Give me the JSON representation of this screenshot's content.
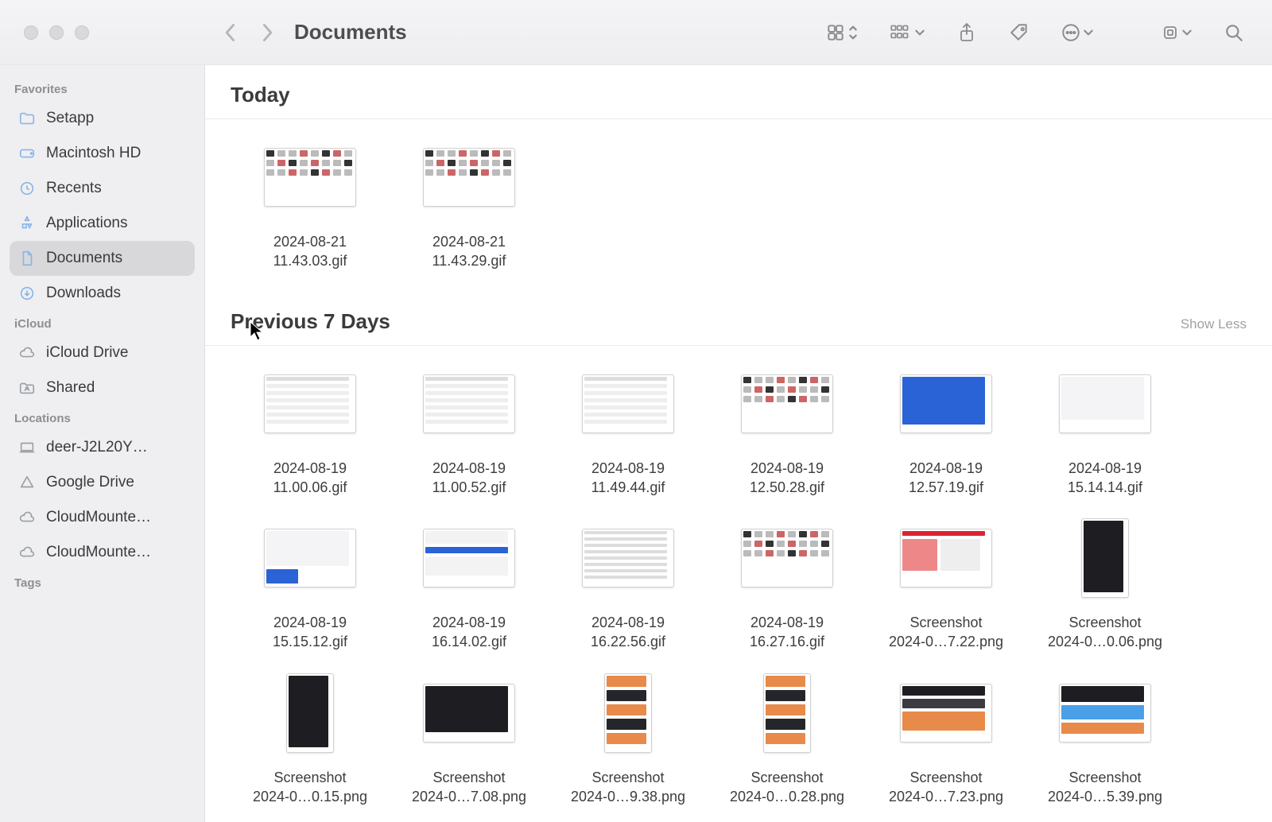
{
  "window": {
    "title": "Documents"
  },
  "sidebar": {
    "sections": [
      {
        "title": "Favorites",
        "items": [
          {
            "icon": "folder",
            "label": "Setapp"
          },
          {
            "icon": "disk",
            "label": "Macintosh HD"
          },
          {
            "icon": "clock",
            "label": "Recents"
          },
          {
            "icon": "apps",
            "label": "Applications"
          },
          {
            "icon": "doc",
            "label": "Documents",
            "selected": true
          },
          {
            "icon": "down",
            "label": "Downloads"
          }
        ]
      },
      {
        "title": "iCloud",
        "items": [
          {
            "icon": "cloud",
            "label": "iCloud Drive"
          },
          {
            "icon": "shared",
            "label": "Shared"
          }
        ]
      },
      {
        "title": "Locations",
        "items": [
          {
            "icon": "laptop",
            "label": "deer-J2L20Y…"
          },
          {
            "icon": "tri",
            "label": "Google Drive"
          },
          {
            "icon": "cloud2",
            "label": "CloudMounte…"
          },
          {
            "icon": "cloud2",
            "label": "CloudMounte…"
          }
        ]
      },
      {
        "title": "Tags",
        "items": []
      }
    ]
  },
  "groups": [
    {
      "title": "Today",
      "show_less": false,
      "files": [
        {
          "thumb": "icons-grid",
          "line1": "2024-08-21",
          "line2": "11.43.03.gif"
        },
        {
          "thumb": "icons-grid",
          "line1": "2024-08-21",
          "line2": "11.43.29.gif"
        }
      ]
    },
    {
      "title": "Previous 7 Days",
      "show_less": true,
      "show_less_label": "Show Less",
      "files": [
        {
          "thumb": "table",
          "line1": "2024-08-19",
          "line2": "11.00.06.gif"
        },
        {
          "thumb": "table",
          "line1": "2024-08-19",
          "line2": "11.00.52.gif"
        },
        {
          "thumb": "table",
          "line1": "2024-08-19",
          "line2": "11.49.44.gif"
        },
        {
          "thumb": "icons-grid",
          "line1": "2024-08-19",
          "line2": "12.50.28.gif"
        },
        {
          "thumb": "blue-panel",
          "line1": "2024-08-19",
          "line2": "12.57.19.gif"
        },
        {
          "thumb": "dialog",
          "line1": "2024-08-19",
          "line2": "15.14.14.gif"
        },
        {
          "thumb": "dialog2",
          "line1": "2024-08-19",
          "line2": "15.15.12.gif"
        },
        {
          "thumb": "blue-row",
          "line1": "2024-08-19",
          "line2": "16.14.02.gif"
        },
        {
          "thumb": "text-rows",
          "line1": "2024-08-19",
          "line2": "16.22.56.gif"
        },
        {
          "thumb": "icons-grid",
          "line1": "2024-08-19",
          "line2": "16.27.16.gif"
        },
        {
          "thumb": "web-orange",
          "line1": "Screenshot",
          "line2": "2024-0…7.22.png"
        },
        {
          "thumb": "tall-dark",
          "line1": "Screenshot",
          "line2": "2024-0…0.06.png"
        },
        {
          "thumb": "tall-dark",
          "line1": "Screenshot",
          "line2": "2024-0…0.15.png"
        },
        {
          "thumb": "dark-hero",
          "line1": "Screenshot",
          "line2": "2024-0…7.08.png"
        },
        {
          "thumb": "tall-lines",
          "line1": "Screenshot",
          "line2": "2024-0…9.38.png"
        },
        {
          "thumb": "tall-lines",
          "line1": "Screenshot",
          "line2": "2024-0…0.28.png"
        },
        {
          "thumb": "dark-list",
          "line1": "Screenshot",
          "line2": "2024-0…7.23.png"
        },
        {
          "thumb": "dark-blue",
          "line1": "Screenshot",
          "line2": "2024-0…5.39.png"
        }
      ]
    }
  ]
}
